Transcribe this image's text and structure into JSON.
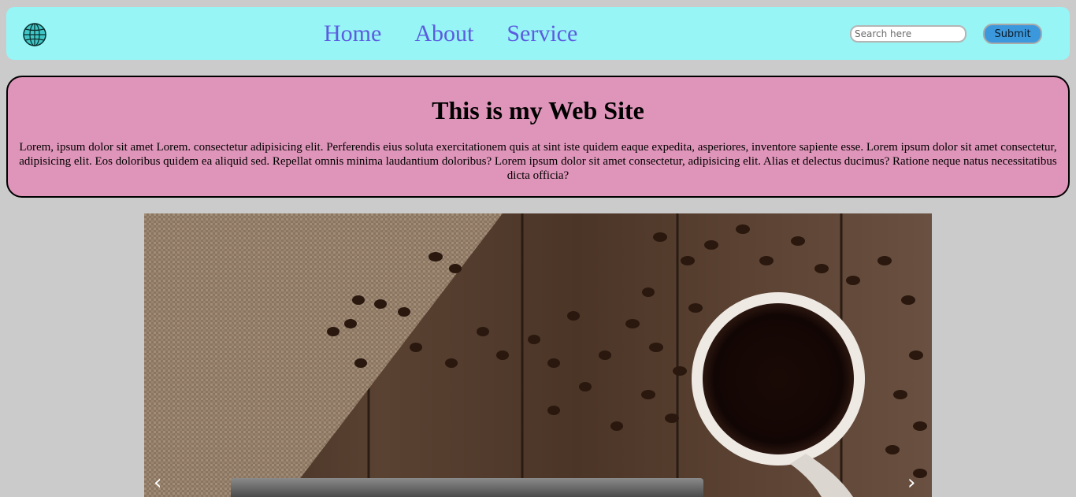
{
  "nav": {
    "logo_icon": "globe-icon",
    "links": [
      "Home",
      "About",
      "Service"
    ],
    "search_placeholder": "Search here",
    "search_value": "",
    "submit_label": "Submit",
    "colors": {
      "bar": "#97f5f5",
      "link": "#5b5ce0",
      "button": "#3c98dc"
    }
  },
  "hero": {
    "title": "This is my Web Site",
    "text": "Lorem, ipsum dolor sit amet Lorem. consectetur adipisicing elit. Perferendis eius soluta exercitationem quis at sint iste quidem eaque expedita, asperiores, inventore sapiente esse. Lorem ipsum dolor sit amet consectetur, adipisicing elit. Eos doloribus quidem ea aliquid sed. Repellat omnis minima laudantium doloribus? Lorem ipsum dolor sit amet consectetur, adipisicing elit. Alias et delectus ducimus? Ratione neque natus necessitatibus dicta officia?",
    "colors": {
      "background": "#df95b9"
    }
  },
  "slider": {
    "image": "coffee-cup-and-beans-photo",
    "prev_label": "‹",
    "next_label": "›"
  }
}
